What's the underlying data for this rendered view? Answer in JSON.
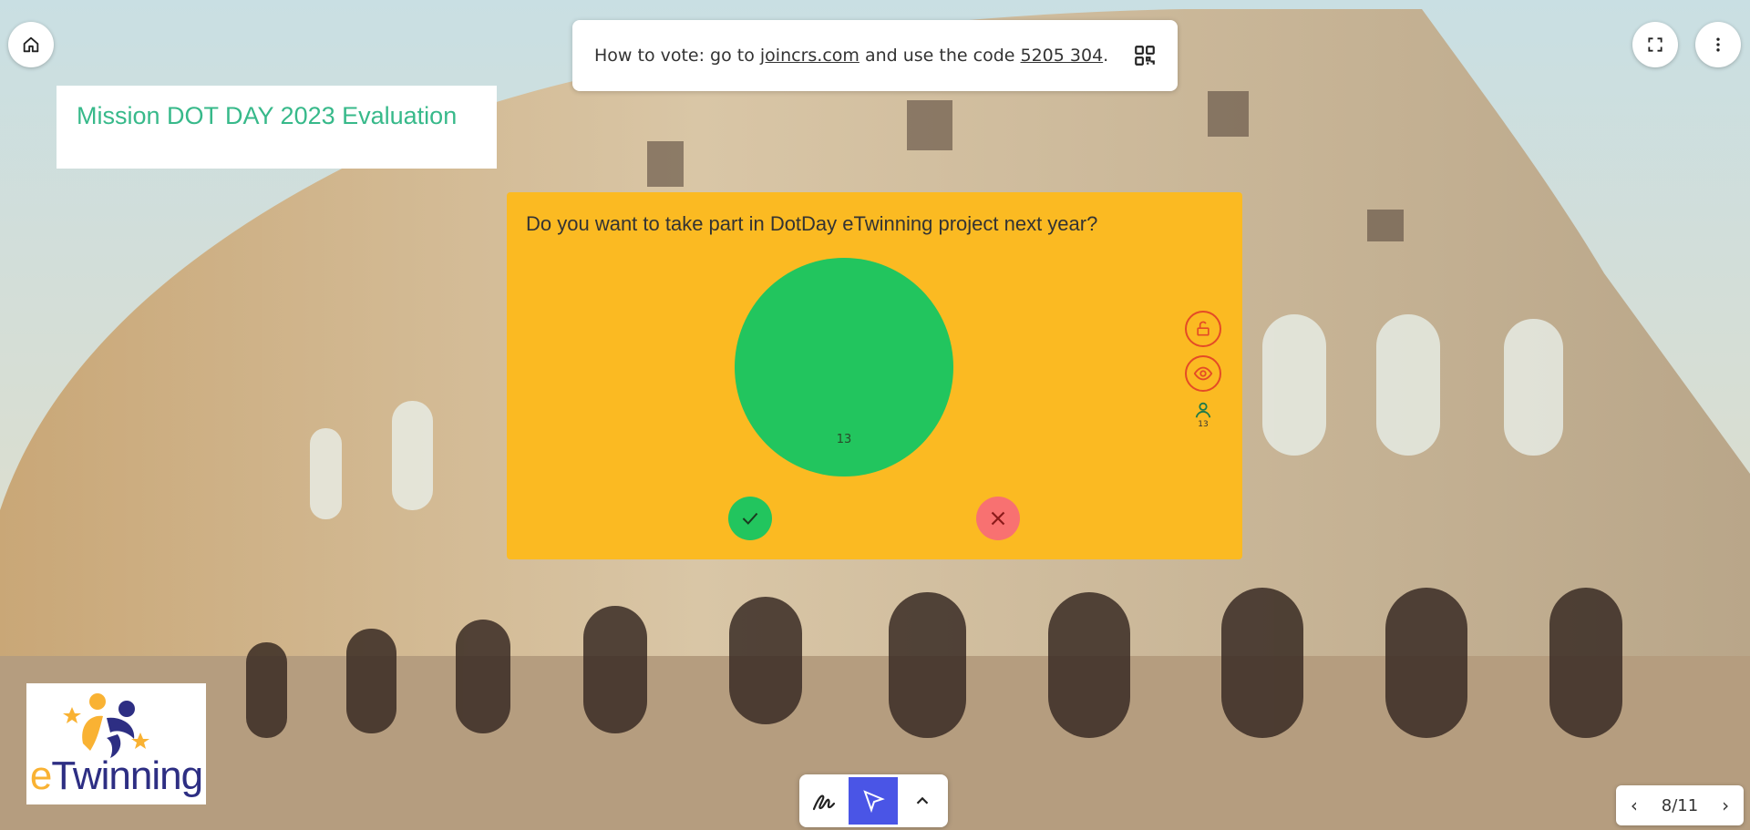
{
  "vote": {
    "prefix": "How to vote: go to",
    "site": "joincrs.com",
    "middle": "and use the code",
    "code": "5205 304",
    "suffix": "."
  },
  "title": "Mission DOT DAY 2023 Evaluation",
  "poll": {
    "question": "Do you want to take part in DotDay eTwinning project next year?",
    "participants": "13",
    "chart_data": {
      "type": "pie",
      "categories": [
        "Yes",
        "No"
      ],
      "values": [
        13,
        0
      ],
      "colors": [
        "#22c55e",
        "#f87171"
      ]
    }
  },
  "logo": {
    "e": "e",
    "rest": "Twinning"
  },
  "pager": {
    "prev": "‹",
    "label": "8/11",
    "next": "›"
  },
  "colors": {
    "poll_bg": "#fbba22",
    "accent": "#4a55e6",
    "title": "#37b98a"
  }
}
